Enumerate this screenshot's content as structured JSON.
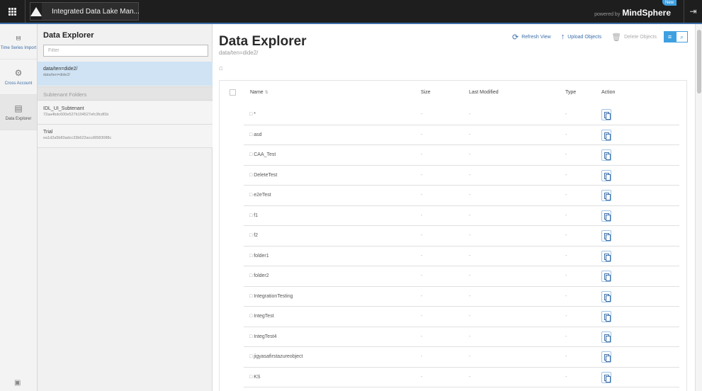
{
  "topbar": {
    "app_title": "Integrated Data Lake Man...",
    "powered_by": "powered by",
    "brand": "MindSphere",
    "badge": "New",
    "logout_icon": "logout-icon"
  },
  "rail": {
    "items": [
      {
        "label": "Time Series Import",
        "icon": "import-icon"
      },
      {
        "label": "Cross Account",
        "icon": "gear-icon"
      },
      {
        "label": "Data Explorer",
        "icon": "explorer-icon"
      }
    ]
  },
  "panel": {
    "title": "Data Explorer",
    "filter_placeholder": "Filter",
    "selected": {
      "name": "data/ten=dide2/",
      "path": "data/ten=dide2/"
    },
    "subtenant_header": "Subtenant Folders",
    "subtenants": [
      {
        "name": "IDL_UI_Subtenant",
        "id": "72aa4bdc600e527b104527efc3fcdf1b"
      },
      {
        "name": "Trial",
        "id": "ea1d2a5b83adcc33b622accd9583088c"
      }
    ]
  },
  "main": {
    "title": "Data Explorer",
    "path": "data/ten=dide2/",
    "toolbar": {
      "refresh": "Refresh View",
      "upload": "Upload Objects",
      "delete": "Delete Objects"
    },
    "table": {
      "headers": {
        "name": "Name",
        "size": "Size",
        "modified": "Last Modified",
        "type": "Type",
        "action": "Action"
      },
      "rows": [
        {
          "name": "*",
          "size": "-",
          "modified": "-",
          "type": "-"
        },
        {
          "name": "asd",
          "size": "-",
          "modified": "-",
          "type": "-"
        },
        {
          "name": "CAA_Test",
          "size": "-",
          "modified": "-",
          "type": "-"
        },
        {
          "name": "DeleteTest",
          "size": "-",
          "modified": "-",
          "type": "-"
        },
        {
          "name": "e2eTest",
          "size": "-",
          "modified": "-",
          "type": "-"
        },
        {
          "name": "f1",
          "size": "-",
          "modified": "-",
          "type": "-"
        },
        {
          "name": "f2",
          "size": "-",
          "modified": "-",
          "type": "-"
        },
        {
          "name": "folder1",
          "size": "-",
          "modified": "-",
          "type": "-"
        },
        {
          "name": "folder2",
          "size": "-",
          "modified": "-",
          "type": "-"
        },
        {
          "name": "IntegrationTesting",
          "size": "-",
          "modified": "-",
          "type": "-"
        },
        {
          "name": "IntegTest",
          "size": "-",
          "modified": "-",
          "type": "-"
        },
        {
          "name": "IntegTest4",
          "size": "-",
          "modified": "-",
          "type": "-"
        },
        {
          "name": "jigyasafirstazureobject",
          "size": "-",
          "modified": "-",
          "type": "-"
        },
        {
          "name": "KS",
          "size": "-",
          "modified": "-",
          "type": "-"
        }
      ]
    }
  },
  "colors": {
    "accent": "#3c6ea8",
    "selected_bg": "#cfe3f4",
    "topbar_bg": "#1e1e1e",
    "view_toggle": "#3fa0e0"
  }
}
